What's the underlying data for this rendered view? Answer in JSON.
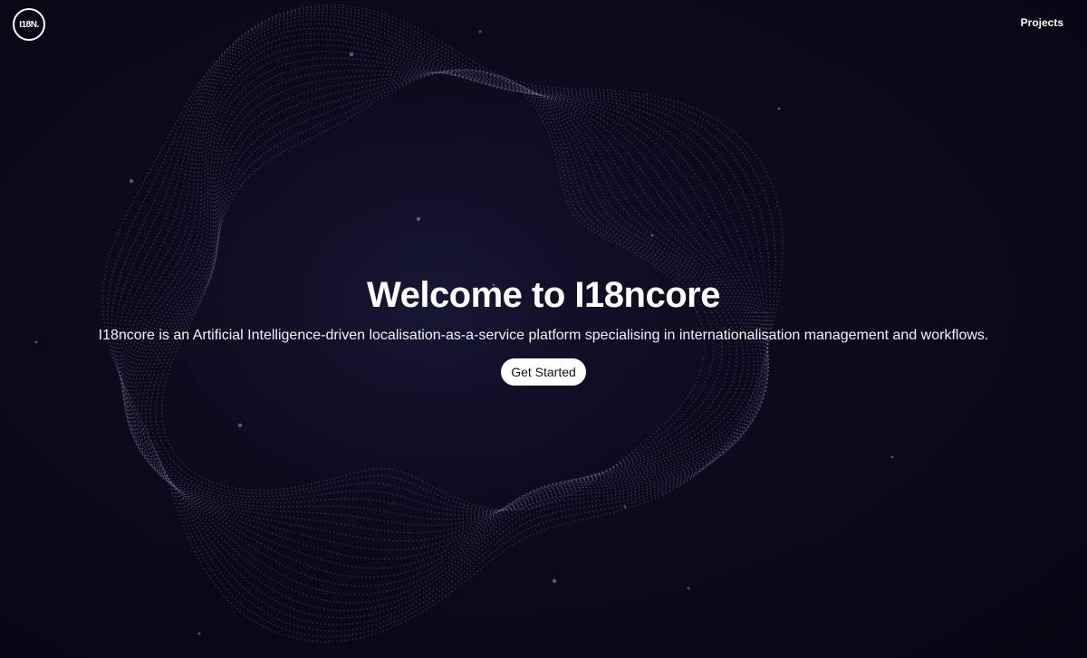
{
  "header": {
    "logo_text": "I18N.",
    "nav_projects": "Projects"
  },
  "hero": {
    "title": "Welcome to I18ncore",
    "subtitle": "I18ncore is an Artificial Intelligence-driven localisation-as-a-service platform specialising in internationalisation management and workflows.",
    "cta_label": "Get Started"
  },
  "colors": {
    "background": "#0a0918",
    "text": "#ffffff",
    "button_bg": "#ffffff",
    "button_text": "#111111"
  }
}
